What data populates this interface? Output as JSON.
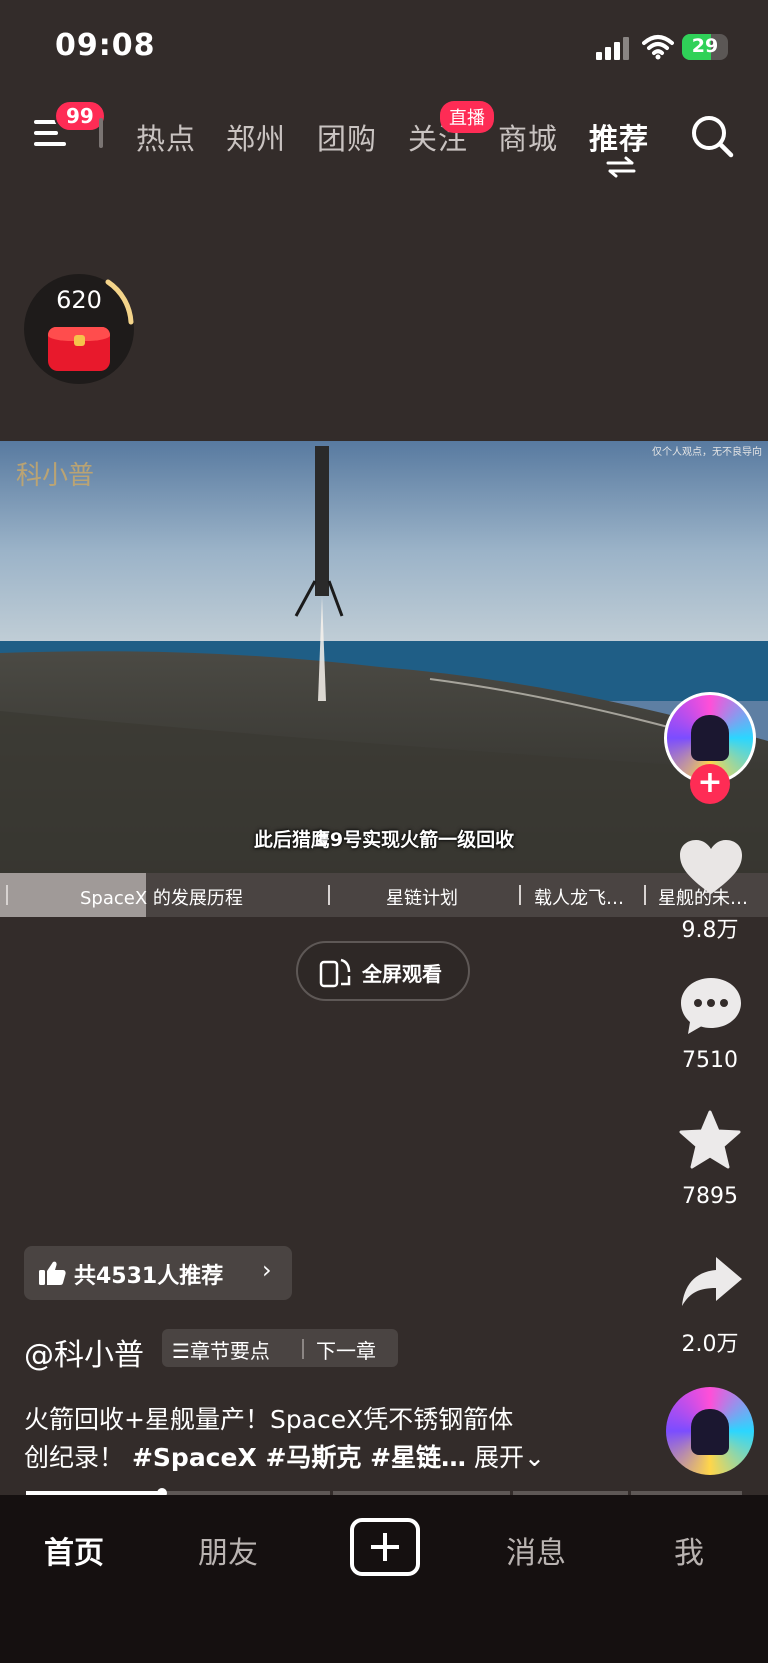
{
  "status_bar": {
    "time": "09:08",
    "battery": "29"
  },
  "top_nav": {
    "menu_badge": "99",
    "tabs": [
      {
        "label": "热点"
      },
      {
        "label": "郑州"
      },
      {
        "label": "团购"
      },
      {
        "label": "关注"
      },
      {
        "label": "商城"
      },
      {
        "label": "推荐"
      }
    ],
    "live_badge": "直播",
    "active_tab": "推荐"
  },
  "red_packet": {
    "count": "620"
  },
  "video": {
    "watermark_logo": "科小普",
    "watermark_note": "仅个人观点，无不良导向",
    "subtitle": "此后猎鹰9号实现火箭一级回收"
  },
  "chapters": [
    {
      "label": "SpaceX 的发展历程"
    },
    {
      "label": "星链计划"
    },
    {
      "label": "载人龙飞…"
    },
    {
      "label": "星舰的未…"
    }
  ],
  "chapter_progress": 0.19,
  "fullscreen_label": "全屏观看",
  "actions": {
    "like_count": "9.8万",
    "comment_count": "7510",
    "favorite_count": "7895",
    "share_count": "2.0万"
  },
  "recommend": {
    "text": "共4531人推荐"
  },
  "author": {
    "name": "@科小普",
    "chapter_points": "章节要点",
    "next_chapter": "下一章"
  },
  "caption": {
    "line1": "火箭回收+星舰量产！SpaceX凭不锈钢箭体",
    "line2_prefix": "创纪录！",
    "tags": "#SpaceX #马斯克 #星链…",
    "expand": "展开"
  },
  "video_progress": 0.19,
  "bottom_nav": {
    "home": "首页",
    "friends": "朋友",
    "messages": "消息",
    "me": "我"
  },
  "colors": {
    "accent": "#fe2c55",
    "background": "#332c2a",
    "nav_bg": "#151010"
  }
}
